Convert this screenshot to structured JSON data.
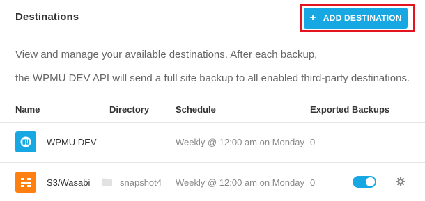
{
  "header": {
    "title": "Destinations",
    "add_button_label": "ADD DESTINATION",
    "add_icon": "plus-icon",
    "highlight_color": "#e3141f"
  },
  "description": {
    "line1": "View and manage your available destinations. After each backup,",
    "line2": "the WPMU DEV API will send a full site backup to all enabled third-party destinations."
  },
  "table": {
    "columns": {
      "name": "Name",
      "directory": "Directory",
      "schedule": "Schedule",
      "exported": "Exported Backups"
    },
    "rows": [
      {
        "icon": "wpmu-dev-logo-icon",
        "name": "WPMU DEV",
        "directory": "",
        "schedule": "Weekly @ 12:00 am on Monday",
        "exported": "0"
      },
      {
        "icon": "s3-wasabi-logo-icon",
        "name": "S3/Wasabi",
        "directory_icon": "folder-icon",
        "directory": "snapshot4",
        "schedule": "Weekly @ 12:00 am on Monday",
        "exported": "0",
        "enabled": true,
        "settings_icon": "gear-icon"
      }
    ]
  },
  "colors": {
    "accent": "#17a8e3",
    "s3_brand": "#ff7f11"
  }
}
